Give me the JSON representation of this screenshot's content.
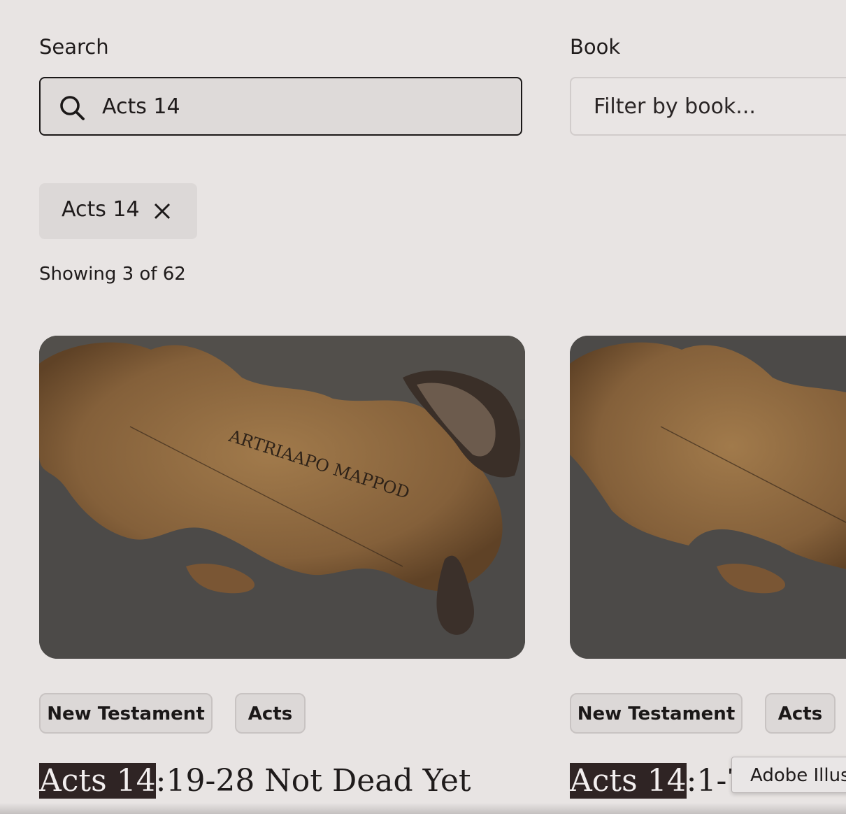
{
  "filters": {
    "search_label": "Search",
    "search_value": "Acts 14",
    "book_label": "Book",
    "book_placeholder": "Filter by book..."
  },
  "active_chip": {
    "label": "Acts 14"
  },
  "results": {
    "count_text": "Showing 3 of 62"
  },
  "cards": [
    {
      "tags": [
        "New Testament",
        "Acts"
      ],
      "title_highlight": "Acts 14",
      "title_rest": ":19-28 Not Dead Yet"
    },
    {
      "tags": [
        "New Testament",
        "Acts"
      ],
      "title_highlight": "Acts 14",
      "title_rest": ":1-7 U"
    }
  ],
  "tooltip": {
    "text": "Adobe Illus"
  },
  "image_text": "ARTRIAAPO MAPPOD",
  "icons": [
    "search-icon",
    "close-icon"
  ],
  "colors": {
    "background": "#e8e4e3",
    "highlight": "#2f2424",
    "tag_background": "#dcd8d7"
  }
}
